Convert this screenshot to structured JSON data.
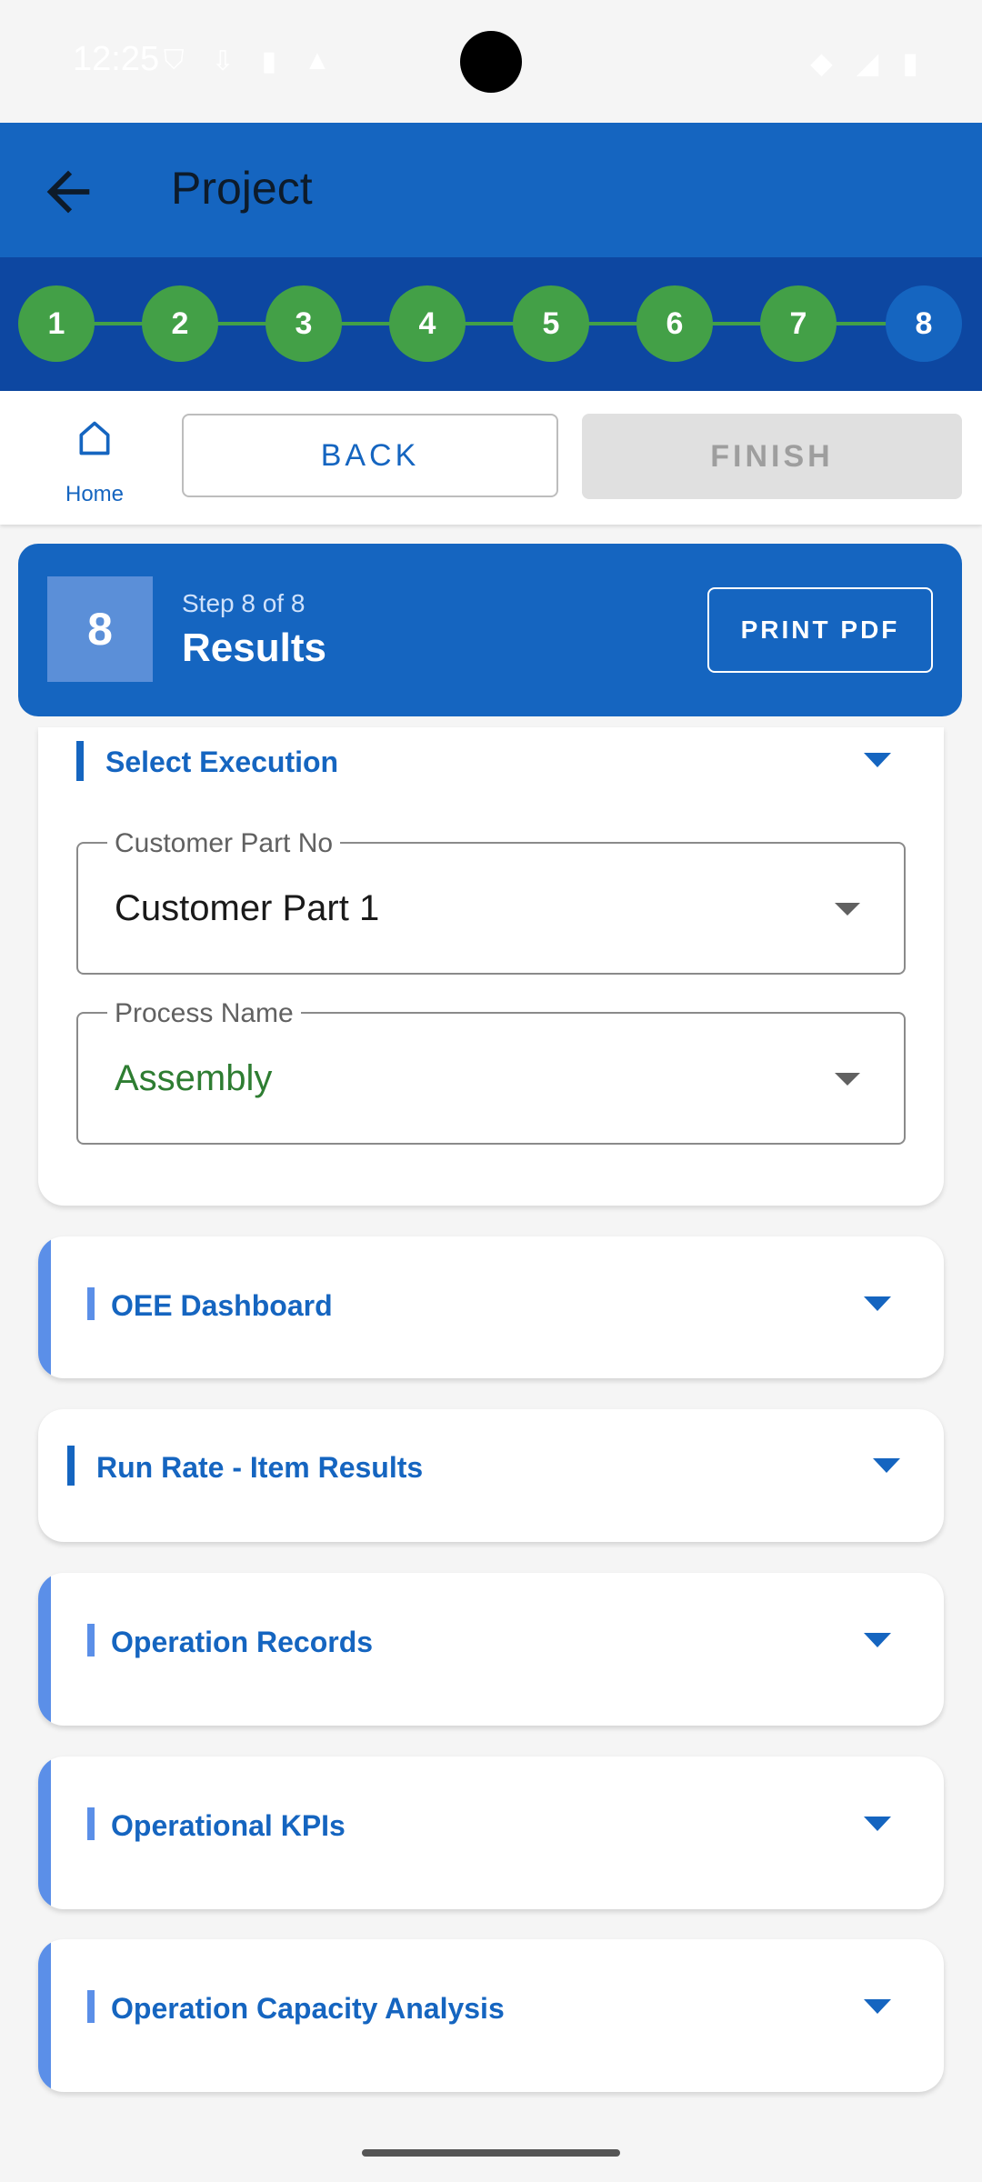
{
  "status_bar": {
    "time": "12:25"
  },
  "app_bar": {
    "title": "Project"
  },
  "stepper": {
    "steps": [
      "1",
      "2",
      "3",
      "4",
      "5",
      "6",
      "7",
      "8"
    ]
  },
  "nav": {
    "home_label": "Home",
    "back_label": "BACK",
    "finish_label": "FINISH"
  },
  "header": {
    "step_number": "8",
    "step_of": "Step 8 of 8",
    "title": "Results",
    "print_label": "PRINT PDF"
  },
  "execution": {
    "title": "Select Execution",
    "customer_part": {
      "label": "Customer Part No",
      "value": "Customer Part 1"
    },
    "process": {
      "label": "Process Name",
      "value": "Assembly",
      "value_color": "#2e7d32"
    }
  },
  "sections": [
    {
      "title": "OEE Dashboard"
    },
    {
      "title": "Run Rate - Item Results"
    },
    {
      "title": "Operation Records"
    },
    {
      "title": "Operational KPIs"
    },
    {
      "title": "Operation Capacity Analysis"
    }
  ],
  "colors": {
    "primary": "#1565c0",
    "primary_dark": "#0d47a1",
    "step_done": "#43a047",
    "accent_light": "#5b8fe8"
  }
}
